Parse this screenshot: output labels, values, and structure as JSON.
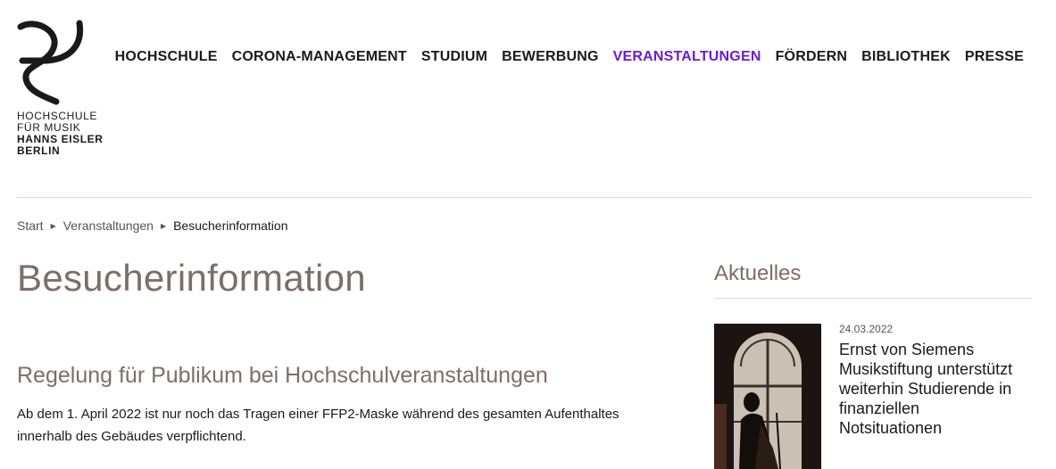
{
  "logo": {
    "line1": "HOCHSCHULE",
    "line2": "FÜR MUSIK",
    "line3": "HANNS EISLER",
    "line4": "BERLIN"
  },
  "nav": {
    "items": [
      {
        "label": "HOCHSCHULE"
      },
      {
        "label": "CORONA-MANAGEMENT"
      },
      {
        "label": "STUDIUM"
      },
      {
        "label": "BEWERBUNG"
      },
      {
        "label": "VERANSTALTUNGEN",
        "active": true
      },
      {
        "label": "FÖRDERN"
      },
      {
        "label": "BIBLIOTHEK"
      },
      {
        "label": "PRESSE"
      }
    ],
    "active_color": "#6a1bd8"
  },
  "breadcrumb": {
    "items": [
      "Start",
      "Veranstaltungen",
      "Besucherinformation"
    ]
  },
  "main": {
    "title": "Besucherinformation",
    "section_title": "Regelung für Publikum bei Hochschulveranstaltungen",
    "section_text": "Ab dem 1. April 2022 ist nur noch das Tragen einer FFP2-Maske während des gesamten Aufenthaltes innerhalb des Gebäudes verpflichtend."
  },
  "aside": {
    "title": "Aktuelles",
    "news": [
      {
        "date": "24.03.2022",
        "headline": "Ernst von Siemens Musikstiftung unterstützt weiterhin Studierende in finanziellen Notsituationen"
      }
    ]
  },
  "colors": {
    "heading": "#7c6f66",
    "text": "#1a1a1a",
    "accent": "#6a1bd8"
  }
}
